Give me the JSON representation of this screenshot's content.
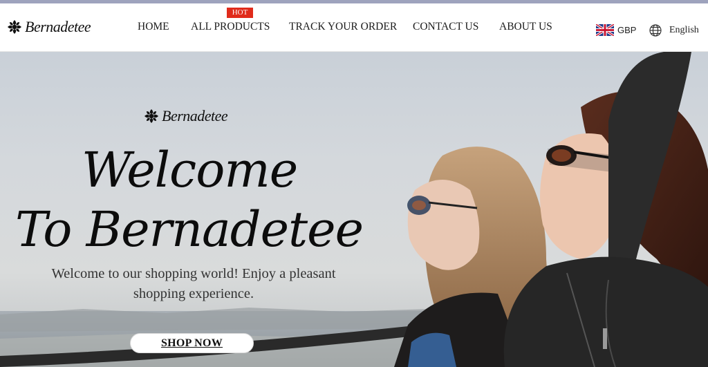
{
  "brand": {
    "name": "Bernadetee",
    "logo_icon": "flower-logo-icon"
  },
  "nav": {
    "items": [
      "HOME",
      "ALL PRODUCTS",
      "TRACK YOUR ORDER",
      "CONTACT US",
      "ABOUT US"
    ],
    "badge": "HOT",
    "badge_color": "#e02b1b"
  },
  "currency": {
    "code": "GBP",
    "flag_icon": "uk-flag-icon"
  },
  "language": {
    "label": "English",
    "icon": "globe-icon"
  },
  "hero": {
    "logo_text": "Bernadetee",
    "title_line1": "Welcome",
    "title_line2": "To Bernadetee",
    "subtitle": "Welcome to our shopping world! Enjoy a pleasant shopping experience.",
    "cta": "SHOP NOW"
  }
}
